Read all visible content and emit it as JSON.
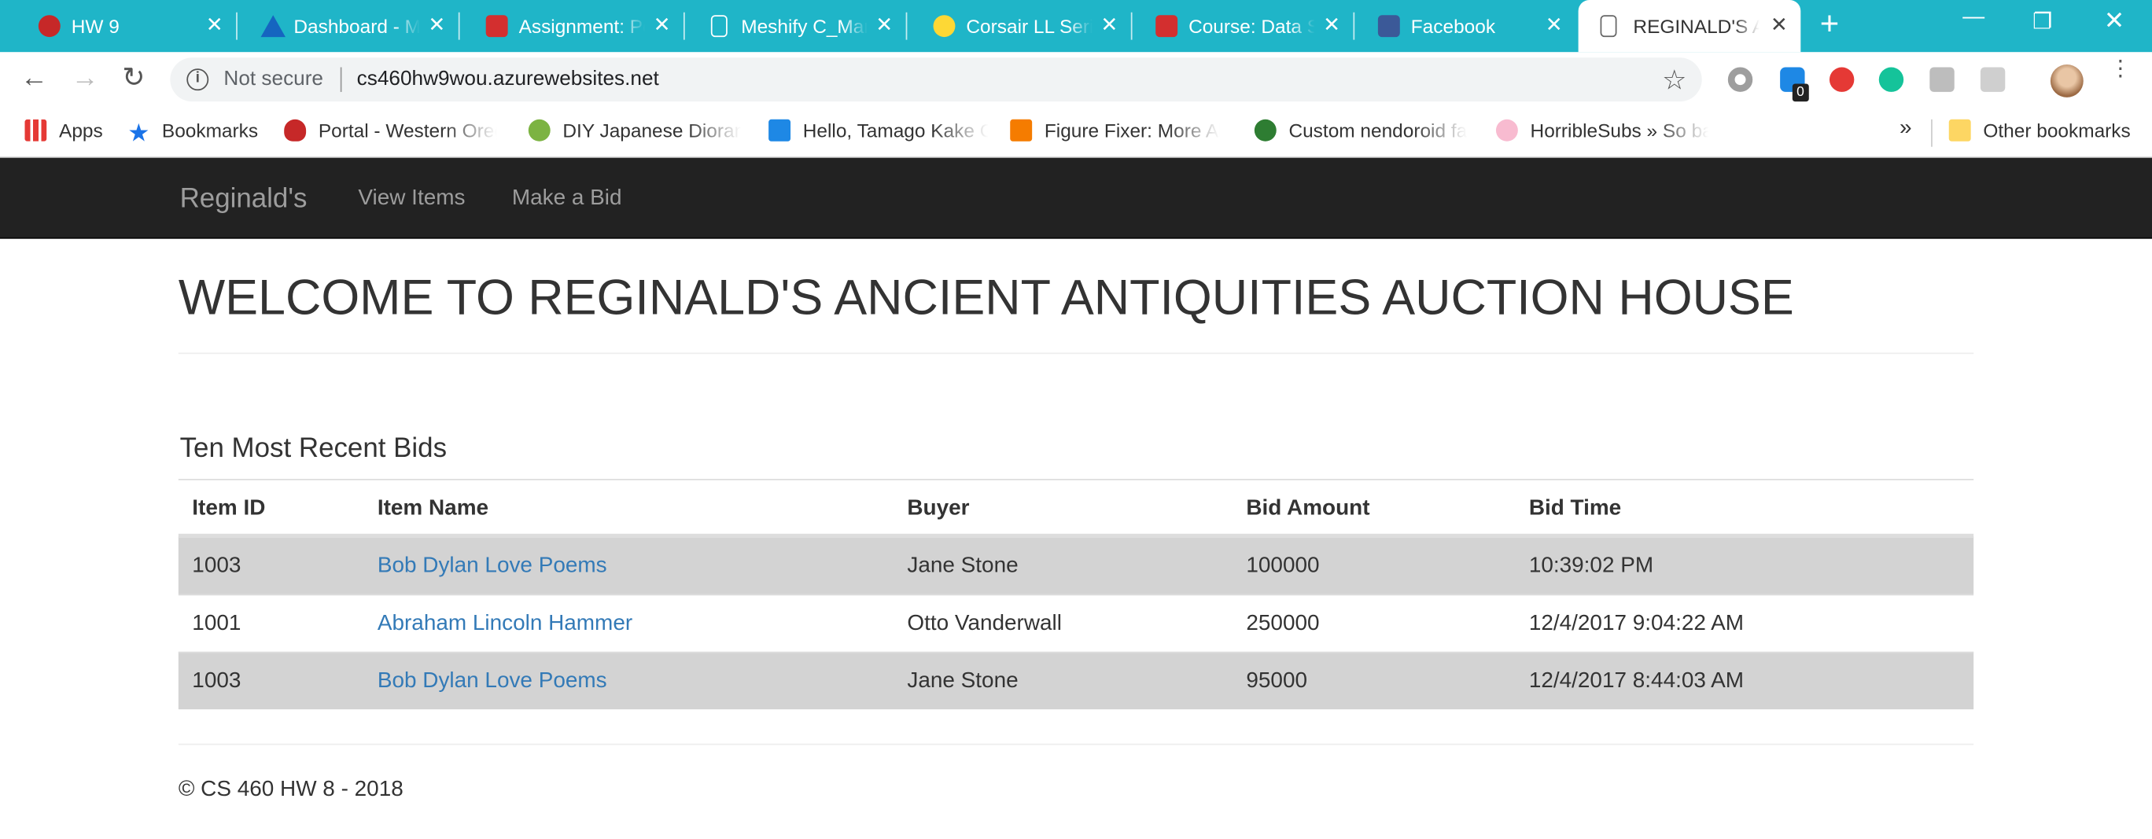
{
  "browser": {
    "tabs": [
      {
        "title": "HW 9",
        "favicon_color": "#c62828"
      },
      {
        "title": "Dashboard - M",
        "favicon_color": "#1565c0"
      },
      {
        "title": "Assignment: Po",
        "favicon_color": "#d32f2f"
      },
      {
        "title": "Meshify C_Man",
        "favicon_color": "#ffffff"
      },
      {
        "title": "Corsair LL Serie",
        "favicon_color": "#fdd835"
      },
      {
        "title": "Course: Data S",
        "favicon_color": "#d32f2f"
      },
      {
        "title": "Facebook",
        "favicon_color": "#3b5998"
      },
      {
        "title": "REGINALD'S AN",
        "favicon_color": "#888888",
        "active": true
      }
    ],
    "close_glyph": "✕",
    "new_tab_glyph": "+",
    "window_buttons": {
      "minimize": "—",
      "restore": "❐",
      "close": "✕"
    },
    "nav": {
      "back": "←",
      "forward": "→",
      "reload": "↻"
    },
    "address_bar": {
      "security_label": "Not secure",
      "url": "cs460hw9wou.azurewebsites.net",
      "info_glyph": "i",
      "star_glyph": "☆"
    },
    "extension_badge": "0",
    "menu_glyph": "⋮",
    "bookmarks": [
      {
        "label": "Apps",
        "icon": "apps-grid-icon"
      },
      {
        "label": "Bookmarks",
        "icon": "star-icon"
      },
      {
        "label": "Portal - Western Oreg",
        "icon": "shield-icon"
      },
      {
        "label": "DIY Japanese Diorama",
        "icon": "jellyfish-icon"
      },
      {
        "label": "Hello, Tamago Kake G",
        "icon": "briefcase-icon"
      },
      {
        "label": "Figure Fixer: More Ab",
        "icon": "blogger-icon"
      },
      {
        "label": "Custom nendoroid fa",
        "icon": "green-p-icon"
      },
      {
        "label": "HorribleSubs » So ba",
        "icon": "flower-icon"
      }
    ],
    "bookmarks_overflow": "»",
    "other_bookmarks": "Other bookmarks"
  },
  "site": {
    "brand": "Reginald's",
    "nav_links": [
      "View Items",
      "Make a Bid"
    ],
    "heading": "WELCOME TO REGINALD'S ANCIENT ANTIQUITIES AUCTION HOUSE",
    "section_title": "Ten Most Recent Bids",
    "table": {
      "headers": [
        "Item ID",
        "Item Name",
        "Buyer",
        "Bid Amount",
        "Bid Time"
      ],
      "rows": [
        [
          "1003",
          "Bob Dylan Love Poems",
          "Jane Stone",
          "100000",
          "10:39:02 PM"
        ],
        [
          "1001",
          "Abraham Lincoln Hammer",
          "Otto Vanderwall",
          "250000",
          "12/4/2017 9:04:22 AM"
        ],
        [
          "1003",
          "Bob Dylan Love Poems",
          "Jane Stone",
          "95000",
          "12/4/2017 8:44:03 AM"
        ]
      ]
    },
    "footer": "© CS 460 HW 8 - 2018"
  },
  "colors": {
    "tab_strip": "#1fb5c8",
    "navbar": "#222222",
    "link": "#337ab7",
    "row_shade": "#d3d3d3"
  }
}
